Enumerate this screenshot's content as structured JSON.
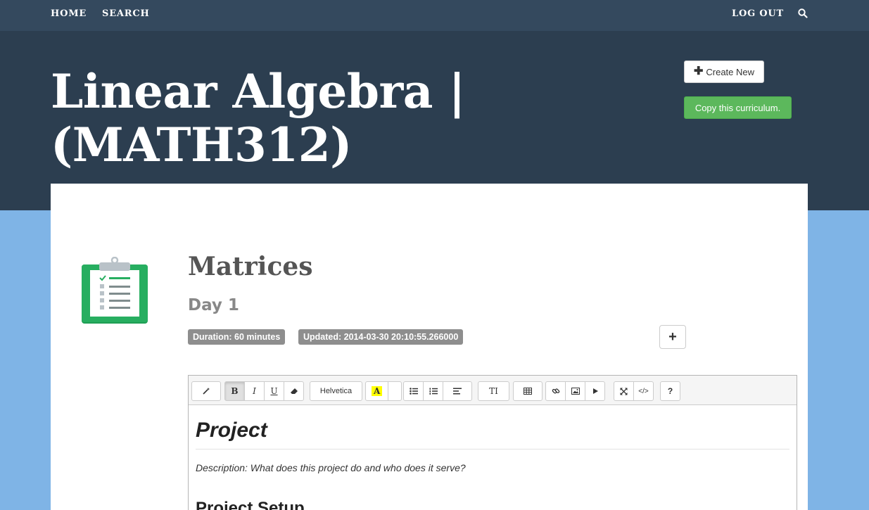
{
  "nav": {
    "home": "HOME",
    "search": "SEARCH",
    "logout": "LOG OUT",
    "search_icon": "search-icon"
  },
  "hero": {
    "title": "Linear Algebra | (MATH312)",
    "create_new": "Create New",
    "copy_curriculum": "Copy this curriculum."
  },
  "lesson": {
    "icon": "clipboard-icon",
    "title": "Matrices",
    "subtitle": "Day 1",
    "badges": {
      "duration": "Duration: 60 minutes",
      "updated": "Updated: 2014-03-30 20:10:55.266000"
    },
    "add_label": "+"
  },
  "editor": {
    "toolbar": {
      "style_icon": "magic-wand-icon",
      "bold": "B",
      "italic": "I",
      "underline": "U",
      "eraser_icon": "eraser-icon",
      "font": "Helvetica",
      "color": "A",
      "ul_icon": "unordered-list-icon",
      "ol_icon": "ordered-list-icon",
      "align_icon": "align-left-icon",
      "line_height": "TI",
      "table_icon": "table-icon",
      "link_icon": "link-icon",
      "picture_icon": "picture-icon",
      "video_icon": "play-icon",
      "fullscreen_icon": "fullscreen-icon",
      "code_label": "</>",
      "help": "?"
    },
    "heading": "Project",
    "description": "Description: What does this project do and who does it serve?",
    "subheading": "Project Setup"
  },
  "colors": {
    "nav_bg": "#34495e",
    "hero_bg": "#2c3e50",
    "page_bg": "#7fb4e6",
    "success": "#5cb85c",
    "badge": "#8e8e8e",
    "icon_green": "#27ae60"
  }
}
